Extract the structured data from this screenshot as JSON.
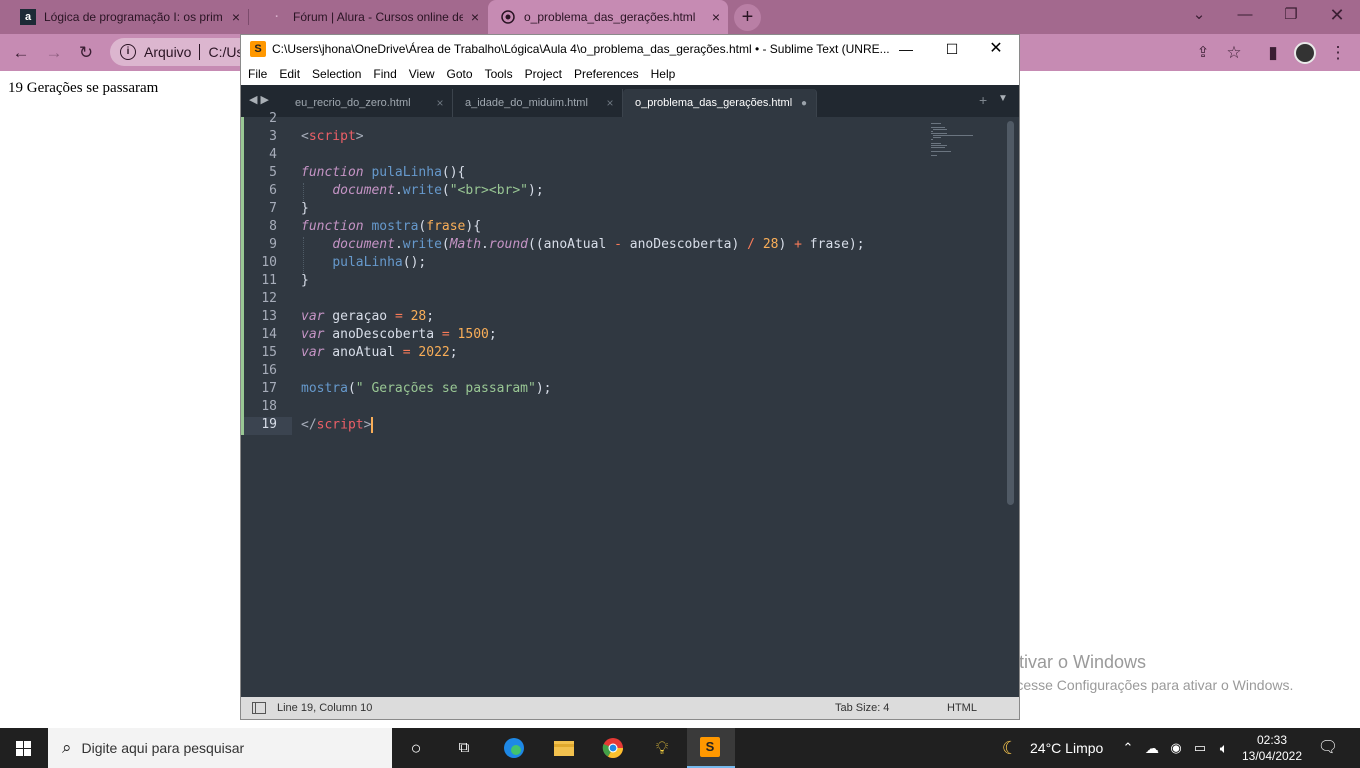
{
  "browser": {
    "tabs": [
      {
        "label": "Lógica de programação I: os prim",
        "favicon": "alura-icon",
        "close": "×"
      },
      {
        "label": "Fórum | Alura - Cursos online de",
        "favicon": "dot-icon",
        "close": "×"
      },
      {
        "label": "o_problema_das_gerações.html",
        "favicon": "globe-icon",
        "close": "×"
      }
    ],
    "new_tab": "+",
    "address": {
      "info_label": "Arquivo",
      "url": "C:/Us"
    },
    "colors": {
      "tabstrip": "#a3698e",
      "toolbar": "#c68bb3"
    }
  },
  "page": {
    "output_text": "19 Gerações se passaram"
  },
  "sublime": {
    "title": "C:\\Users\\jhona\\OneDrive\\Área de Trabalho\\Lógica\\Aula 4\\o_problema_das_gerações.html • - Sublime Text (UNRE...",
    "menu": [
      "File",
      "Edit",
      "Selection",
      "Find",
      "View",
      "Goto",
      "Tools",
      "Project",
      "Preferences",
      "Help"
    ],
    "tabs": [
      {
        "label": "eu_recrio_do_zero.html",
        "close": "×"
      },
      {
        "label": "a_idade_do_miduim.html",
        "close": "×"
      },
      {
        "label": "o_problema_das_gerações.html",
        "close": "●"
      }
    ],
    "line_numbers": [
      "2",
      "3",
      "4",
      "5",
      "6",
      "7",
      "8",
      "9",
      "10",
      "11",
      "12",
      "13",
      "14",
      "15",
      "16",
      "17",
      "18",
      "19"
    ],
    "status": {
      "position": "Line 19, Column 10",
      "tab_size": "Tab Size: 4",
      "syntax": "HTML"
    }
  },
  "watermark": {
    "title": "Ativar o Windows",
    "subtitle": "Acesse Configurações para ativar o Windows."
  },
  "taskbar": {
    "search_placeholder": "Digite aqui para pesquisar",
    "weather": "24°C  Limpo",
    "time": "02:33",
    "date": "13/04/2022"
  }
}
